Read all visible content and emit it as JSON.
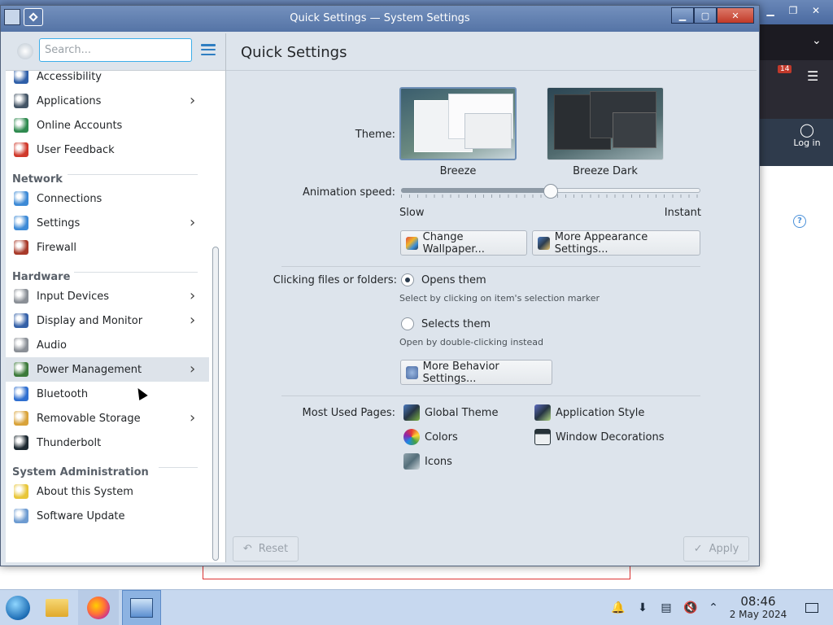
{
  "window": {
    "title": "Quick Settings — System Settings"
  },
  "sidebar": {
    "search_placeholder": "Search...",
    "items": [
      {
        "label": "Accessibility",
        "chevron": false,
        "icon": "accessibility-icon"
      },
      {
        "label": "Applications",
        "chevron": true,
        "icon": "applications-icon"
      },
      {
        "label": "Online Accounts",
        "chevron": false,
        "icon": "online-accounts-icon"
      },
      {
        "label": "User Feedback",
        "chevron": false,
        "icon": "user-feedback-icon"
      },
      {
        "category": "Network"
      },
      {
        "label": "Connections",
        "chevron": false,
        "icon": "connections-icon"
      },
      {
        "label": "Settings",
        "chevron": true,
        "icon": "network-settings-icon"
      },
      {
        "label": "Firewall",
        "chevron": false,
        "icon": "firewall-icon"
      },
      {
        "category": "Hardware"
      },
      {
        "label": "Input Devices",
        "chevron": true,
        "icon": "input-devices-icon"
      },
      {
        "label": "Display and Monitor",
        "chevron": true,
        "icon": "display-icon"
      },
      {
        "label": "Audio",
        "chevron": false,
        "icon": "audio-icon"
      },
      {
        "label": "Power Management",
        "chevron": true,
        "icon": "power-icon",
        "selected": true
      },
      {
        "label": "Bluetooth",
        "chevron": false,
        "icon": "bluetooth-icon"
      },
      {
        "label": "Removable Storage",
        "chevron": true,
        "icon": "storage-icon"
      },
      {
        "label": "Thunderbolt",
        "chevron": false,
        "icon": "thunderbolt-icon"
      },
      {
        "category": "System Administration"
      },
      {
        "label": "About this System",
        "chevron": false,
        "icon": "about-icon"
      },
      {
        "label": "Software Update",
        "chevron": false,
        "icon": "software-update-icon"
      }
    ]
  },
  "main": {
    "title": "Quick Settings",
    "theme_label": "Theme:",
    "themes": [
      {
        "label": "Breeze",
        "selected": true
      },
      {
        "label": "Breeze Dark",
        "selected": false
      }
    ],
    "animation_label": "Animation speed:",
    "animation_slow": "Slow",
    "animation_instant": "Instant",
    "animation_value": 0.5,
    "change_wallpaper": "Change Wallpaper...",
    "more_appearance": "More Appearance Settings...",
    "clicking_label": "Clicking files or folders:",
    "opens_them": "Opens them",
    "opens_hint": "Select by clicking on item's selection marker",
    "selects_them": "Selects them",
    "selects_hint": "Open by double-clicking instead",
    "more_behavior": "More Behavior Settings...",
    "most_used_label": "Most Used Pages:",
    "pages": {
      "global_theme": "Global Theme",
      "application_style": "Application Style",
      "colors": "Colors",
      "window_decorations": "Window Decorations",
      "icons": "Icons"
    },
    "reset": "Reset",
    "apply": "Apply"
  },
  "bg_window": {
    "login": "Log in",
    "badge": "14"
  },
  "taskbar": {
    "time": "08:46",
    "date": "2 May 2024"
  },
  "colors": {
    "accent": "#3daee9",
    "selection": "#dde3ea",
    "titlebar": "#5a79ab"
  }
}
